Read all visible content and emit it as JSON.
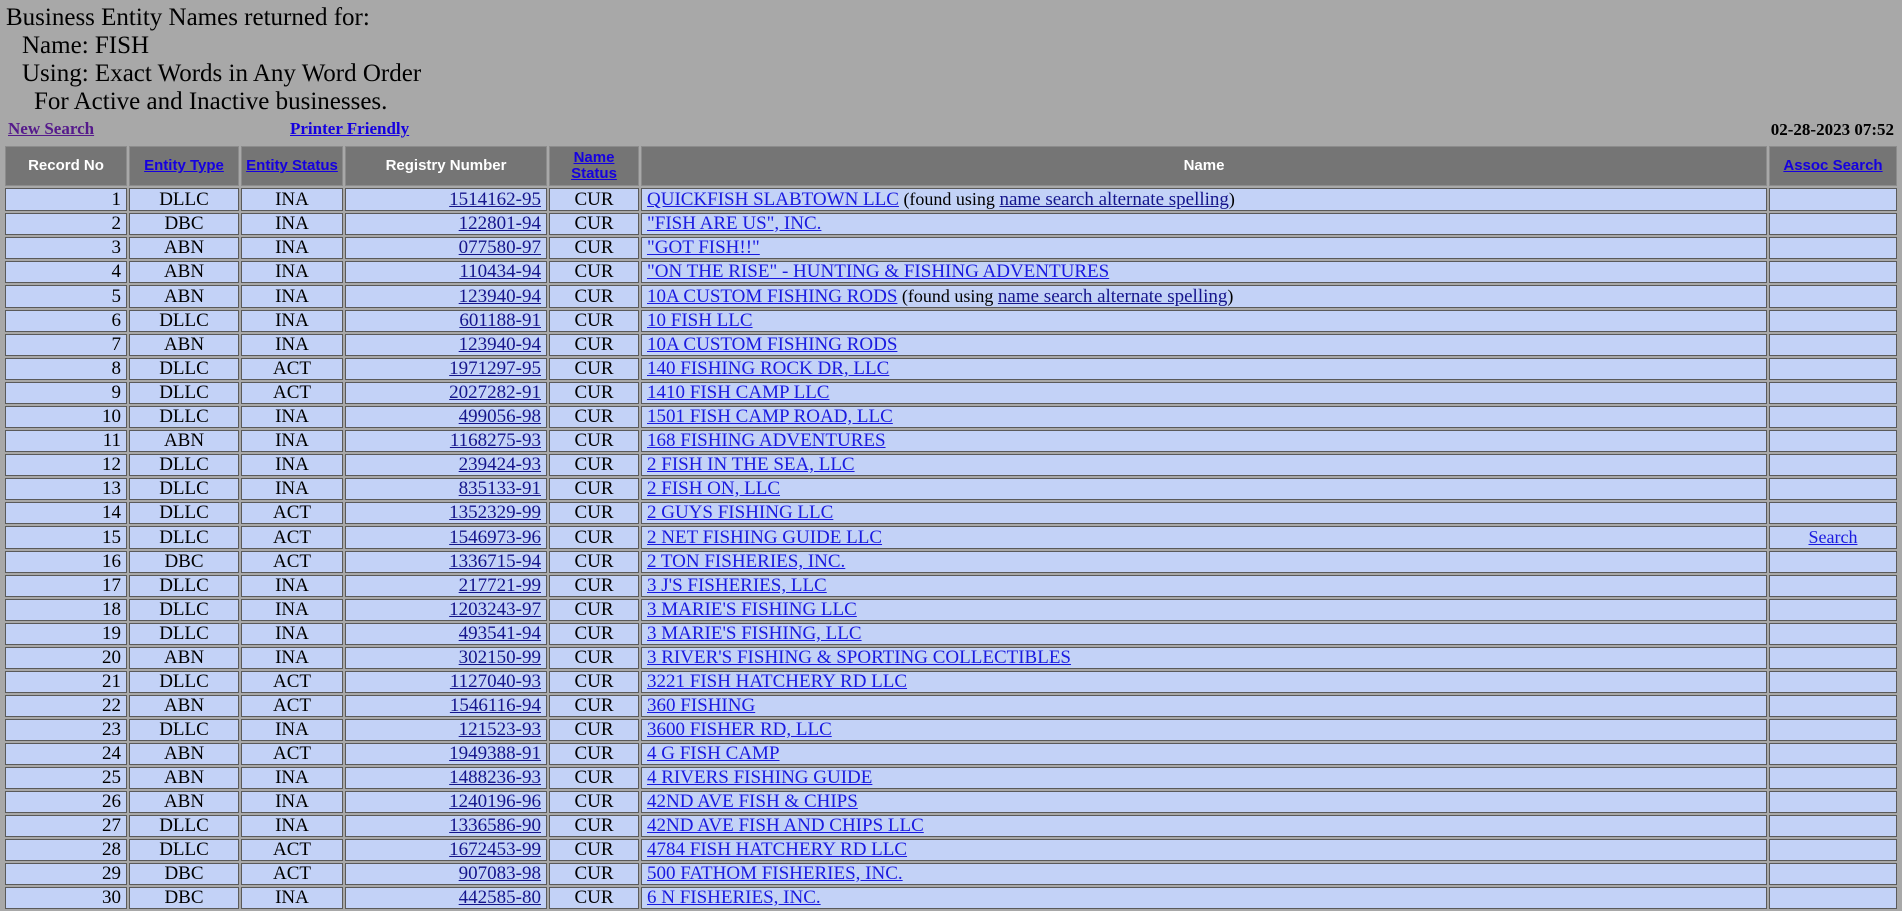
{
  "header": {
    "line1": "Business Entity Names returned for:",
    "line2": "Name: FISH",
    "line3": "Using: Exact Words in Any Word Order",
    "line4": "For Active and Inactive businesses."
  },
  "links": {
    "new_search": "New Search",
    "printer_friendly": "Printer Friendly"
  },
  "timestamp": "02-28-2023 07:52",
  "table": {
    "columns": [
      {
        "label": "Record No",
        "link": false
      },
      {
        "label": "Entity Type",
        "link": true
      },
      {
        "label": "Entity Status",
        "link": true
      },
      {
        "label": "Registry Number",
        "link": false
      },
      {
        "label": "Name Status",
        "link": true
      },
      {
        "label": "Name",
        "link": false
      },
      {
        "label": "Assoc Search",
        "link": true
      }
    ],
    "alt_note_prefix": "  (found using ",
    "alt_note_link": "name search alternate spelling",
    "alt_note_suffix": ")",
    "assoc_label": "Search",
    "rows": [
      {
        "no": "1",
        "type": "DLLC",
        "status": "INA",
        "registry": "1514162-95",
        "name_status": "CUR",
        "name": "QUICKFISH SLABTOWN LLC",
        "alt": true,
        "assoc": false
      },
      {
        "no": "2",
        "type": "DBC",
        "status": "INA",
        "registry": "122801-94",
        "name_status": "CUR",
        "name": "\"FISH ARE US\", INC.",
        "alt": false,
        "assoc": false
      },
      {
        "no": "3",
        "type": "ABN",
        "status": "INA",
        "registry": "077580-97",
        "name_status": "CUR",
        "name": "\"GOT FISH!!\"",
        "alt": false,
        "assoc": false
      },
      {
        "no": "4",
        "type": "ABN",
        "status": "INA",
        "registry": "110434-94",
        "name_status": "CUR",
        "name": "\"ON THE RISE\" - HUNTING & FISHING ADVENTURES",
        "alt": false,
        "assoc": false
      },
      {
        "no": "5",
        "type": "ABN",
        "status": "INA",
        "registry": "123940-94",
        "name_status": "CUR",
        "name": "10A CUSTOM FISHING RODS",
        "alt": true,
        "assoc": false
      },
      {
        "no": "6",
        "type": "DLLC",
        "status": "INA",
        "registry": "601188-91",
        "name_status": "CUR",
        "name": "10 FISH LLC",
        "alt": false,
        "assoc": false
      },
      {
        "no": "7",
        "type": "ABN",
        "status": "INA",
        "registry": "123940-94",
        "name_status": "CUR",
        "name": "10A CUSTOM FISHING RODS",
        "alt": false,
        "assoc": false
      },
      {
        "no": "8",
        "type": "DLLC",
        "status": "ACT",
        "registry": "1971297-95",
        "name_status": "CUR",
        "name": "140 FISHING ROCK DR, LLC",
        "alt": false,
        "assoc": false
      },
      {
        "no": "9",
        "type": "DLLC",
        "status": "ACT",
        "registry": "2027282-91",
        "name_status": "CUR",
        "name": "1410 FISH CAMP LLC",
        "alt": false,
        "assoc": false
      },
      {
        "no": "10",
        "type": "DLLC",
        "status": "INA",
        "registry": "499056-98",
        "name_status": "CUR",
        "name": "1501 FISH CAMP ROAD, LLC",
        "alt": false,
        "assoc": false
      },
      {
        "no": "11",
        "type": "ABN",
        "status": "INA",
        "registry": "1168275-93",
        "name_status": "CUR",
        "name": "168 FISHING ADVENTURES",
        "alt": false,
        "assoc": false
      },
      {
        "no": "12",
        "type": "DLLC",
        "status": "INA",
        "registry": "239424-93",
        "name_status": "CUR",
        "name": "2 FISH IN THE SEA, LLC",
        "alt": false,
        "assoc": false
      },
      {
        "no": "13",
        "type": "DLLC",
        "status": "INA",
        "registry": "835133-91",
        "name_status": "CUR",
        "name": "2 FISH ON, LLC",
        "alt": false,
        "assoc": false
      },
      {
        "no": "14",
        "type": "DLLC",
        "status": "ACT",
        "registry": "1352329-99",
        "name_status": "CUR",
        "name": "2 GUYS FISHING LLC",
        "alt": false,
        "assoc": false
      },
      {
        "no": "15",
        "type": "DLLC",
        "status": "ACT",
        "registry": "1546973-96",
        "name_status": "CUR",
        "name": "2 NET FISHING GUIDE LLC",
        "alt": false,
        "assoc": true
      },
      {
        "no": "16",
        "type": "DBC",
        "status": "ACT",
        "registry": "1336715-94",
        "name_status": "CUR",
        "name": "2 TON FISHERIES, INC.",
        "alt": false,
        "assoc": false
      },
      {
        "no": "17",
        "type": "DLLC",
        "status": "INA",
        "registry": "217721-99",
        "name_status": "CUR",
        "name": "3 J'S FISHERIES, LLC",
        "alt": false,
        "assoc": false
      },
      {
        "no": "18",
        "type": "DLLC",
        "status": "INA",
        "registry": "1203243-97",
        "name_status": "CUR",
        "name": "3 MARIE'S FISHING LLC",
        "alt": false,
        "assoc": false
      },
      {
        "no": "19",
        "type": "DLLC",
        "status": "INA",
        "registry": "493541-94",
        "name_status": "CUR",
        "name": "3 MARIE'S FISHING, LLC",
        "alt": false,
        "assoc": false
      },
      {
        "no": "20",
        "type": "ABN",
        "status": "INA",
        "registry": "302150-99",
        "name_status": "CUR",
        "name": "3 RIVER'S FISHING & SPORTING COLLECTIBLES",
        "alt": false,
        "assoc": false
      },
      {
        "no": "21",
        "type": "DLLC",
        "status": "ACT",
        "registry": "1127040-93",
        "name_status": "CUR",
        "name": "3221 FISH HATCHERY RD LLC",
        "alt": false,
        "assoc": false
      },
      {
        "no": "22",
        "type": "ABN",
        "status": "ACT",
        "registry": "1546116-94",
        "name_status": "CUR",
        "name": "360 FISHING",
        "alt": false,
        "assoc": false
      },
      {
        "no": "23",
        "type": "DLLC",
        "status": "INA",
        "registry": "121523-93",
        "name_status": "CUR",
        "name": "3600 FISHER RD, LLC",
        "alt": false,
        "assoc": false
      },
      {
        "no": "24",
        "type": "ABN",
        "status": "ACT",
        "registry": "1949388-91",
        "name_status": "CUR",
        "name": "4 G FISH CAMP",
        "alt": false,
        "assoc": false
      },
      {
        "no": "25",
        "type": "ABN",
        "status": "INA",
        "registry": "1488236-93",
        "name_status": "CUR",
        "name": "4 RIVERS FISHING GUIDE",
        "alt": false,
        "assoc": false
      },
      {
        "no": "26",
        "type": "ABN",
        "status": "INA",
        "registry": "1240196-96",
        "name_status": "CUR",
        "name": "42ND AVE FISH & CHIPS",
        "alt": false,
        "assoc": false
      },
      {
        "no": "27",
        "type": "DLLC",
        "status": "INA",
        "registry": "1336586-90",
        "name_status": "CUR",
        "name": "42ND AVE FISH AND CHIPS LLC",
        "alt": false,
        "assoc": false
      },
      {
        "no": "28",
        "type": "DLLC",
        "status": "ACT",
        "registry": "1672453-99",
        "name_status": "CUR",
        "name": "4784 FISH HATCHERY RD LLC",
        "alt": false,
        "assoc": false
      },
      {
        "no": "29",
        "type": "DBC",
        "status": "ACT",
        "registry": "907083-98",
        "name_status": "CUR",
        "name": "500 FATHOM FISHERIES, INC.",
        "alt": false,
        "assoc": false
      },
      {
        "no": "30",
        "type": "DBC",
        "status": "INA",
        "registry": "442585-80",
        "name_status": "CUR",
        "name": "6 N FISHERIES, INC.",
        "alt": false,
        "assoc": false
      }
    ]
  },
  "colors": {
    "page_background": "#a8a8a8",
    "header_row": "#757575",
    "row_background": "#c3d2f7",
    "link_blue": "#1500e0",
    "visited_purple": "#551a8b"
  }
}
